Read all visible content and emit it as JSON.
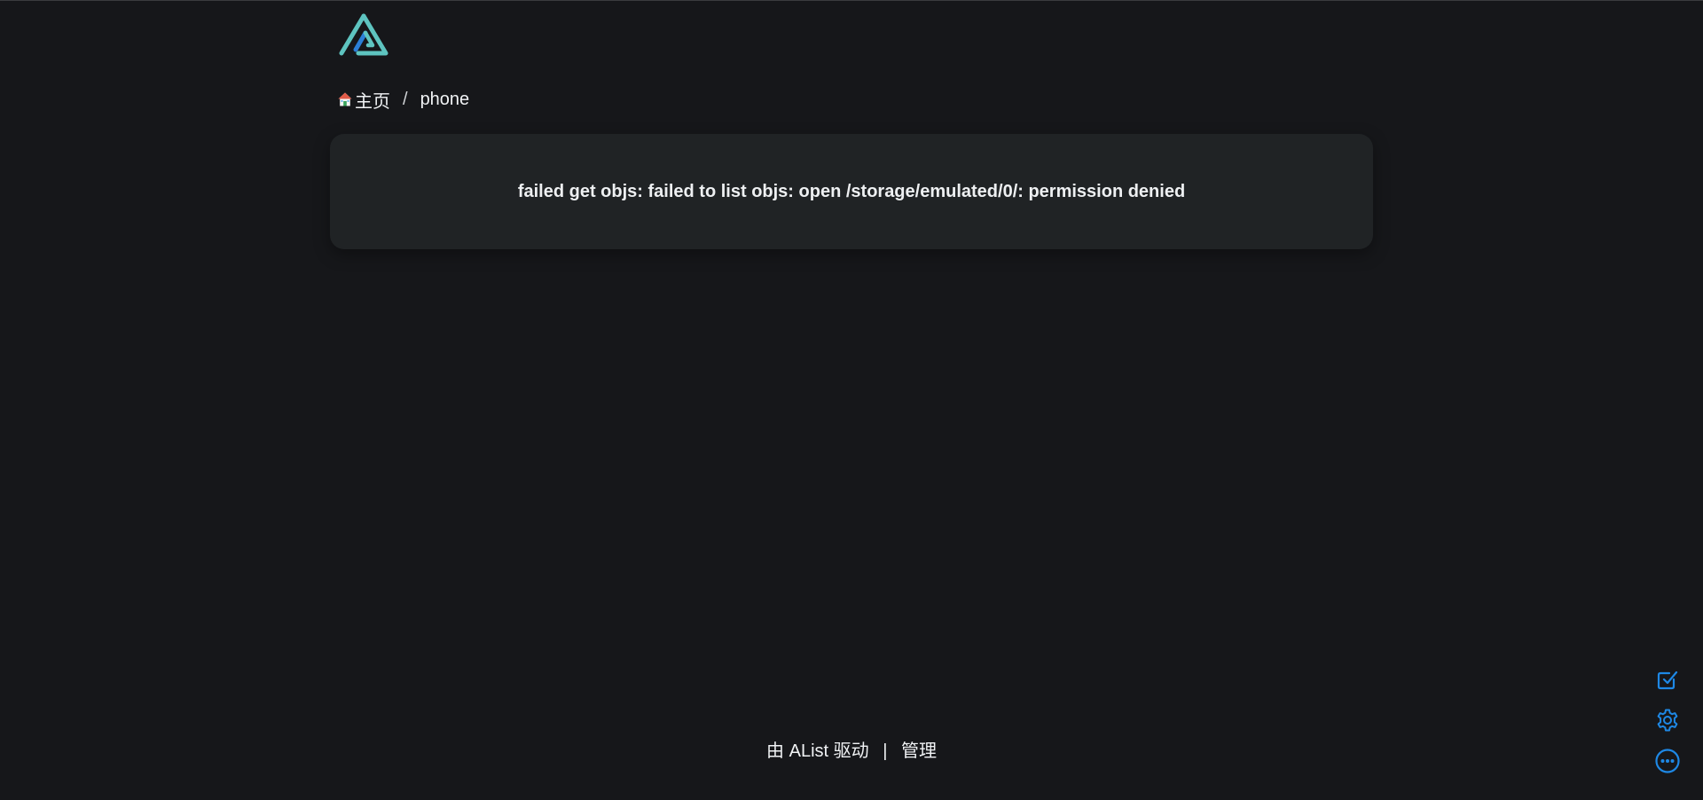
{
  "breadcrumb": {
    "home_label": "主页",
    "separator": "/",
    "current": "phone"
  },
  "error": {
    "message": "failed get objs: failed to list objs: open /storage/emulated/0/: permission denied"
  },
  "footer": {
    "powered_by": "由 AList 驱动",
    "divider": "|",
    "manage_link": "管理"
  },
  "icons": {
    "logo": "alist-logo",
    "home": "house-icon",
    "tools": [
      "checkbox-icon",
      "gear-icon",
      "more-circle-icon"
    ]
  },
  "colors": {
    "background": "#16171a",
    "card": "#202325",
    "accent": "#1e88e5",
    "logo_teal": "#5ec4c0",
    "logo_blue": "#2b7fd6"
  }
}
